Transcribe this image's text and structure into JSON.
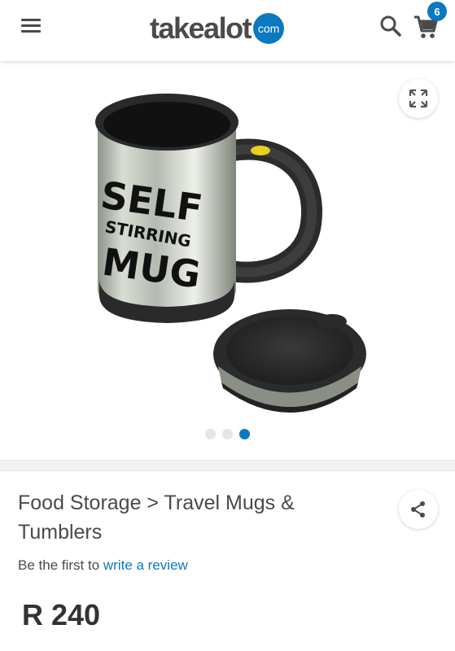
{
  "header": {
    "logo_word": "takealot",
    "logo_badge": "com",
    "cart_count": "6",
    "icons": [
      "hamburger-menu-icon",
      "search-icon",
      "cart-icon"
    ]
  },
  "gallery": {
    "mug_text": [
      "SELF",
      "STIRRING",
      "MUG"
    ],
    "image_count": 3,
    "active_image_index": 2,
    "icons": [
      "expand-icon"
    ]
  },
  "product": {
    "breadcrumb": "Food Storage > Travel Mugs & Tumblers",
    "review_prefix": "Be the first to ",
    "review_link": "write a review",
    "price": "R 240",
    "icons": [
      "share-icon"
    ]
  },
  "colors": {
    "brand_blue": "#0b79bf",
    "text": "#4a4a4a",
    "price_text": "#333333"
  }
}
